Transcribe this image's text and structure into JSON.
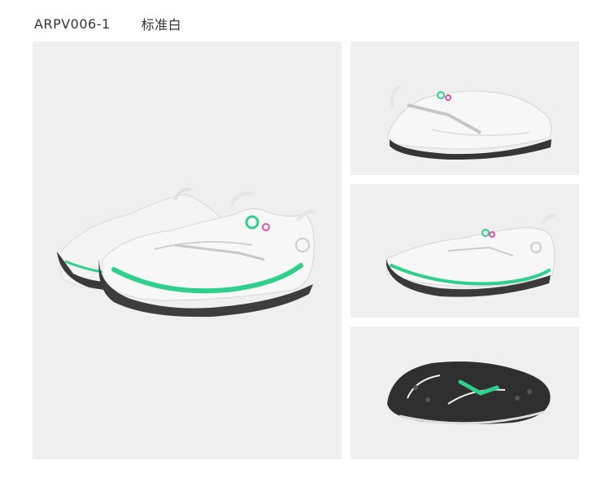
{
  "header": {
    "model_code": "ARPV006-1",
    "color_name": "标准白"
  },
  "gallery": {
    "images": [
      {
        "view": "pair-three-quarter-view"
      },
      {
        "view": "side-view-left"
      },
      {
        "view": "side-view-right"
      },
      {
        "view": "outsole-view"
      }
    ]
  },
  "colors": {
    "panel_bg": "#efefef",
    "shoe_white": "#f6f6f6",
    "accent_green": "#2fd08c",
    "accent_pink": "#e04fb0",
    "outsole_dark": "#3a3a3a"
  }
}
